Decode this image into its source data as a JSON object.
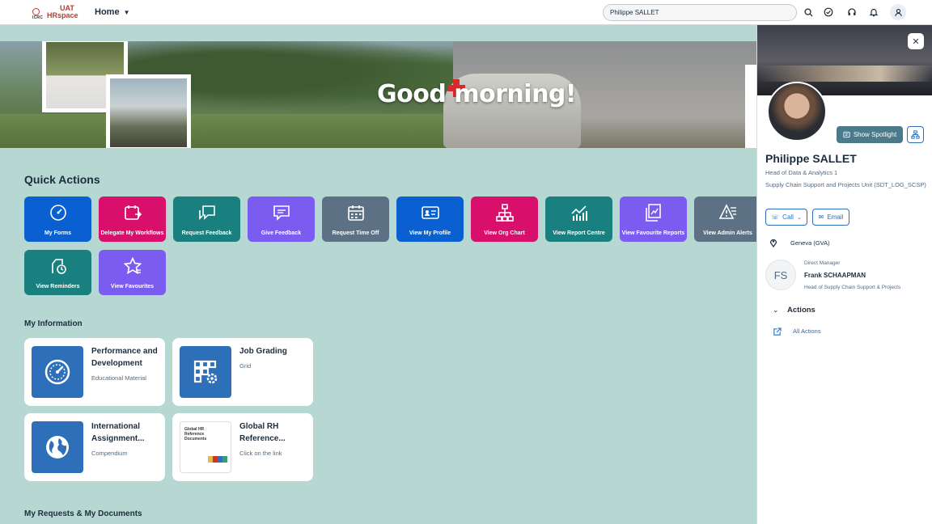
{
  "header": {
    "logo_org": "ICRC",
    "logo_env": "UAT",
    "logo_app": "HRspace",
    "home_label": "Home",
    "search_value": "Philippe SALLET"
  },
  "banner": {
    "greeting": "Good morning!"
  },
  "quick_actions": {
    "title": "Quick Actions",
    "tiles": [
      {
        "label": "My Forms",
        "icon": "gauge-icon",
        "color": "#0a5fd1"
      },
      {
        "label": "Delegate My Workflows",
        "icon": "calendar-forward-icon",
        "color": "#d8106c"
      },
      {
        "label": "Request Feedback",
        "icon": "feedback-request-icon",
        "color": "#1a7f7f"
      },
      {
        "label": "Give Feedback",
        "icon": "feedback-icon",
        "color": "#7a5cf0"
      },
      {
        "label": "Request Time Off",
        "icon": "calendar-icon",
        "color": "#5d7185"
      },
      {
        "label": "View My Profile",
        "icon": "id-card-icon",
        "color": "#0a5fd1"
      },
      {
        "label": "View Org Chart",
        "icon": "org-chart-icon",
        "color": "#d8106c"
      },
      {
        "label": "View Report Centre",
        "icon": "line-chart-icon",
        "color": "#1a7f7f"
      },
      {
        "label": "View Favourite Reports",
        "icon": "reports-icon",
        "color": "#7a5cf0"
      },
      {
        "label": "View Admin Alerts",
        "icon": "alert-icon",
        "color": "#5d7185"
      },
      {
        "label": "View Reminders",
        "icon": "reminder-icon",
        "color": "#1a7f7f"
      },
      {
        "label": "View Favourites",
        "icon": "star-icon",
        "color": "#7a5cf0"
      }
    ]
  },
  "my_information": {
    "title": "My Information",
    "cards": [
      {
        "title": "Performance and Development",
        "subtitle": "Educational Material",
        "icon": "gauge-icon"
      },
      {
        "title": "Job Grading",
        "subtitle": "Grid",
        "icon": "grid-settings-icon"
      },
      {
        "title": "International Assignment...",
        "subtitle": "Compendium",
        "icon": "globe-icon"
      },
      {
        "title": "Global RH Reference...",
        "subtitle": "Click on the link",
        "icon": "document-thumbnail",
        "thumb_text": "Global HR Reference Documents"
      }
    ]
  },
  "my_requests": {
    "title": "My Requests & My Documents"
  },
  "profile_panel": {
    "name": "Philippe SALLET",
    "role": "Head of Data & Analytics 1",
    "unit": "Supply Chain Support and Projects Unit (SDT_LOG_SCSP)",
    "spotlight_label": "Show Spotlight",
    "call_label": "Call",
    "email_label": "Email",
    "location": "Geneva (GVA)",
    "manager": {
      "caption": "Direct Manager",
      "initials": "FS",
      "name": "Frank SCHAAPMAN",
      "role": "Head of Supply Chain Support & Projects"
    },
    "actions_title": "Actions",
    "all_actions_label": "All Actions"
  }
}
